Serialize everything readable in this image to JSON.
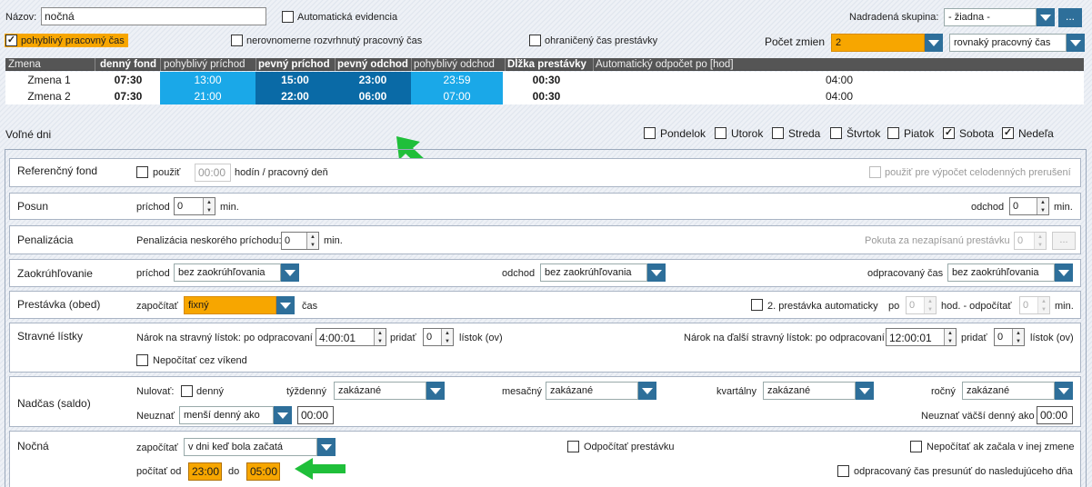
{
  "header": {
    "name_label": "Názov:",
    "name_value": "nočná",
    "auto_label": "Automatická evidencia",
    "parent_label": "Nadradená skupina:",
    "parent_value": "- žiadna -",
    "more_label": "..."
  },
  "options": {
    "flexible": "pohyblivý pracovný čas",
    "uneven": "nerovnomerne rozvrhnutý pracovný čas",
    "limited_break": "ohraničený čas prestávky",
    "shift_count_label": "Počet zmien",
    "shift_count_value": "2",
    "distribution_value": "rovnaký pracovný čas"
  },
  "grid": {
    "columns": [
      "Zmena",
      "denný fond",
      "pohyblivý príchod",
      "pevný príchod",
      "pevný odchod",
      "pohyblivý odchod",
      "Dĺžka prestávky",
      "Automatický odpočet po [hod]"
    ],
    "rows": [
      {
        "name": "Zmena 1",
        "fund": "07:30",
        "flex_in": "13:00",
        "fixed_in": "15:00",
        "fixed_out": "23:00",
        "flex_out": "23:59",
        "break": "00:30",
        "auto": "04:00"
      },
      {
        "name": "Zmena 2",
        "fund": "07:30",
        "flex_in": "21:00",
        "fixed_in": "22:00",
        "fixed_out": "06:00",
        "flex_out": "07:00",
        "break": "00:30",
        "auto": "04:00"
      }
    ]
  },
  "days": {
    "label": "Voľné dni",
    "items": [
      {
        "name": "Pondelok",
        "checked": false
      },
      {
        "name": "Utorok",
        "checked": false
      },
      {
        "name": "Streda",
        "checked": false
      },
      {
        "name": "Štvrtok",
        "checked": false
      },
      {
        "name": "Piatok",
        "checked": false
      },
      {
        "name": "Sobota",
        "checked": true
      },
      {
        "name": "Nedeľa",
        "checked": true
      }
    ]
  },
  "ref": {
    "title": "Referenčný fond",
    "use": "použiť",
    "time": "00:00",
    "unit": "hodín / pracovný deň",
    "right": "použiť pre výpočet celodenných prerušení"
  },
  "posun": {
    "title": "Posun",
    "arrival": "príchod",
    "arrival_val": "0",
    "min": "min.",
    "departure": "odchod",
    "departure_val": "0"
  },
  "pen": {
    "title": "Penalizácia",
    "late": "Penalizácia neskorého príchodu:",
    "late_val": "0",
    "min": "min.",
    "fine": "Pokuta za nezapísanú prestávku",
    "fine_val": "0"
  },
  "round": {
    "title": "Zaokrúhľovanie",
    "arrival": "príchod",
    "departure": "odchod",
    "worked": "odpracovaný čas",
    "value": "bez zaokrúhľovania"
  },
  "lunch": {
    "title": "Prestávka (obed)",
    "count": "započítať",
    "value": "fixný",
    "time": "čas",
    "second": "2. prestávka automaticky",
    "after": "po",
    "after_val": "0",
    "hod": "hod. - odpočítať",
    "sub_val": "0",
    "min": "min."
  },
  "meal": {
    "title": "Stravné lístky",
    "claim": "Nárok na stravný lístok: po odpracovaní",
    "claim_val": "4:00:01",
    "add": "pridať",
    "add_val": "0",
    "unit": "lístok (ov)",
    "claim2": "Nárok na ďalší stravný lístok: po odpracovaní",
    "claim2_val": "12:00:01",
    "add2_val": "0",
    "weekend": "Nepočítať cez víkend"
  },
  "ot": {
    "title": "Nadčas (saldo)",
    "reset": "Nulovať:",
    "daily": "denný",
    "weekly": "týždenný",
    "weekly_val": "zakázané",
    "monthly": "mesačný",
    "monthly_val": "zakázané",
    "quarterly": "kvartálny",
    "quarterly_val": "zakázané",
    "yearly": "ročný",
    "yearly_val": "zakázané",
    "ignore": "Neuznať",
    "ignore_val": "menší denný ako",
    "ignore_time": "00:00",
    "ignore2": "Neuznať väčší denný ako",
    "ignore2_time": "00:00"
  },
  "night": {
    "title": "Nočná",
    "count": "započítať",
    "count_val": "v dni keď bola začatá",
    "from": "počítať od",
    "from_val": "23:00",
    "to": "do",
    "to_val": "05:00",
    "sub_break": "Odpočítať prestávku",
    "not_other": "Nepočítať ak začala v inej zmene",
    "shift_worked": "odpracovaný čas presunúť do nasledujúceho dňa"
  },
  "colors": {
    "accent_orange": "#f7a600",
    "light_blue": "#1aa8e8",
    "dark_blue": "#0a6aa6",
    "arrow_green": "#1fbf3a"
  }
}
